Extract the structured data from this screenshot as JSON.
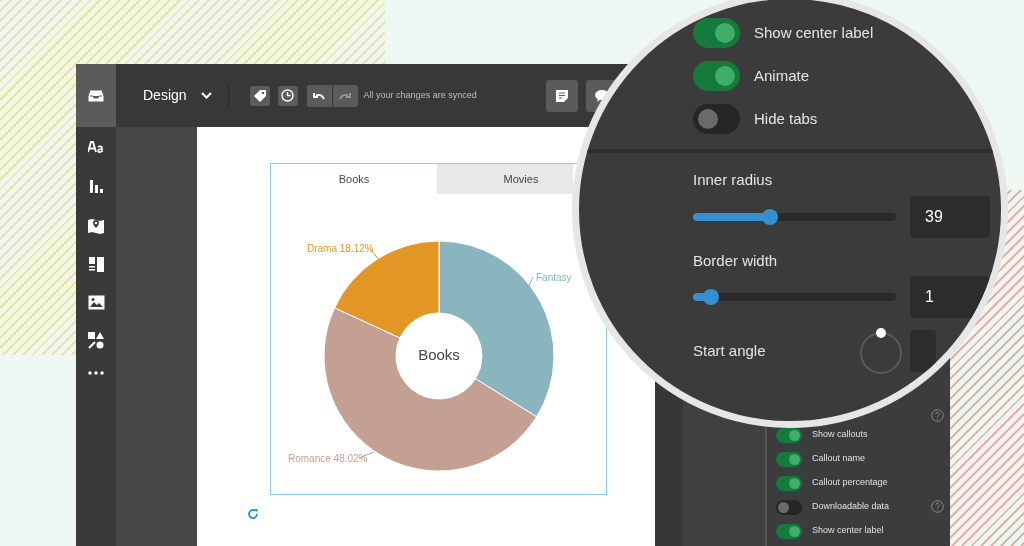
{
  "toolbar": {
    "mode": "Design",
    "sync_status": "All your changes are synced"
  },
  "chart_card": {
    "tabs": [
      {
        "label": "Books",
        "selected": true
      },
      {
        "label": "Movies",
        "selected": false
      }
    ],
    "chart_data": {
      "type": "donut",
      "categories": [
        "Fantasy",
        "Romance 48.02%",
        "Drama 18.12%"
      ],
      "series": [
        {
          "name": "Books",
          "values": [
            33.86,
            48.02,
            18.12
          ]
        }
      ],
      "colors": [
        "#8ab5be",
        "#c4a093",
        "#e29626"
      ]
    }
  },
  "magnifier": {
    "toggles": [
      {
        "label": "Show center label",
        "on": true
      },
      {
        "label": "Animate",
        "on": true
      },
      {
        "label": "Hide tabs",
        "on": false
      }
    ],
    "sliders": [
      {
        "label": "Inner radius",
        "level": 0.38,
        "value": "39"
      },
      {
        "label": "Border width",
        "level": 0.09,
        "value": "1"
      }
    ],
    "start_angle": {
      "label": "Start angle"
    }
  },
  "settings_panel": {
    "toggles": [
      {
        "label": "Show callouts",
        "on": true,
        "help": false
      },
      {
        "label": "Callout name",
        "on": true,
        "help": false
      },
      {
        "label": "Callout percentage",
        "on": true,
        "help": false
      },
      {
        "label": "Downloadable data",
        "on": false,
        "help": true
      },
      {
        "label": "Show center label",
        "on": true,
        "help": false
      }
    ]
  }
}
